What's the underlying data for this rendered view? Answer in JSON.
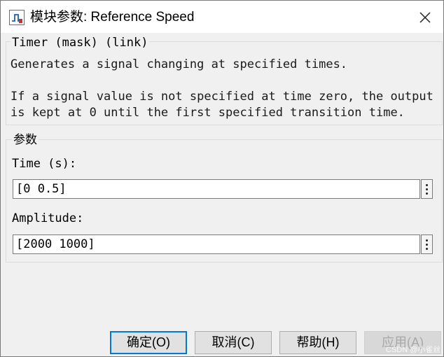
{
  "window": {
    "title": "模块参数: Reference Speed",
    "app_icon": "simulink-block-icon",
    "close_icon": "close-icon"
  },
  "mask_group": {
    "legend": "Timer (mask) (link)",
    "desc_line1": "Generates a signal changing at specified times.",
    "desc_line2": "If a signal value is not specified at time zero, the output",
    "desc_line3": "is kept at 0 until the first specified transition time."
  },
  "params_group": {
    "legend": "参数",
    "time_label": "Time (s):",
    "time_value": "[0 0.5]",
    "amplitude_label": "Amplitude:",
    "amplitude_value": "[2000 1000]",
    "more_icon": "vertical-ellipsis-icon"
  },
  "buttons": {
    "ok": "确定(O)",
    "cancel": "取消(C)",
    "help": "帮助(H)",
    "apply": "应用(A)"
  },
  "watermark": "CSDN @小雀丝",
  "colors": {
    "accent": "#0078d7",
    "dialog_bg": "#f0f0f0",
    "titlebar_bg": "#ffffff"
  }
}
